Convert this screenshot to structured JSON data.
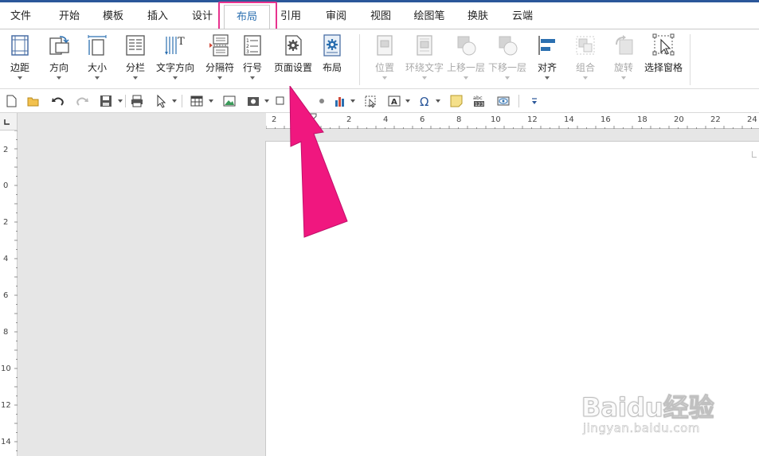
{
  "menu": {
    "tabs": [
      {
        "label": "文件"
      },
      {
        "label": "开始"
      },
      {
        "label": "模板"
      },
      {
        "label": "插入"
      },
      {
        "label": "设计"
      },
      {
        "label": "布局"
      },
      {
        "label": "引用"
      },
      {
        "label": "审阅"
      },
      {
        "label": "视图"
      },
      {
        "label": "绘图笔"
      },
      {
        "label": "换肤"
      },
      {
        "label": "云端"
      }
    ],
    "active_tab": "布局"
  },
  "ribbon": {
    "buttons": [
      {
        "label": "边距",
        "icon": "margins-icon",
        "enabled": true
      },
      {
        "label": "方向",
        "icon": "orientation-icon",
        "enabled": true
      },
      {
        "label": "大小",
        "icon": "size-icon",
        "enabled": true
      },
      {
        "label": "分栏",
        "icon": "columns-icon",
        "enabled": true
      },
      {
        "label": "文字方向",
        "icon": "text-direction-icon",
        "enabled": true
      },
      {
        "label": "分隔符",
        "icon": "breaks-icon",
        "enabled": true
      },
      {
        "label": "行号",
        "icon": "line-numbers-icon",
        "enabled": true
      },
      {
        "label": "页面设置",
        "icon": "page-setup-icon",
        "enabled": true
      },
      {
        "label": "布局",
        "icon": "layout-gear-icon",
        "enabled": true
      },
      {
        "label": "位置",
        "icon": "position-icon",
        "enabled": false
      },
      {
        "label": "环绕文字",
        "icon": "wrap-text-icon",
        "enabled": false
      },
      {
        "label": "上移一层",
        "icon": "bring-forward-icon",
        "enabled": false
      },
      {
        "label": "下移一层",
        "icon": "send-backward-icon",
        "enabled": false
      },
      {
        "label": "对齐",
        "icon": "align-icon",
        "enabled": true
      },
      {
        "label": "组合",
        "icon": "group-icon",
        "enabled": false
      },
      {
        "label": "旋转",
        "icon": "rotate-icon",
        "enabled": false
      },
      {
        "label": "选择窗格",
        "icon": "selection-pane-icon",
        "enabled": true
      }
    ]
  },
  "ruler": {
    "horizontal_ticks": [
      "2",
      "2",
      "4",
      "6",
      "8",
      "10",
      "12",
      "14",
      "16",
      "18",
      "20",
      "22",
      "24"
    ],
    "vertical_ticks": [
      "2",
      "0",
      "2",
      "4",
      "6",
      "8",
      "10",
      "12",
      "14"
    ]
  },
  "watermark": {
    "logo": "Baidu经验",
    "url": "jingyan.baidu.com"
  },
  "colors": {
    "accent": "#2b579a",
    "active_tab_text": "#2b6fb0",
    "highlight": "#e8338e",
    "arrow": "#f0177f"
  }
}
